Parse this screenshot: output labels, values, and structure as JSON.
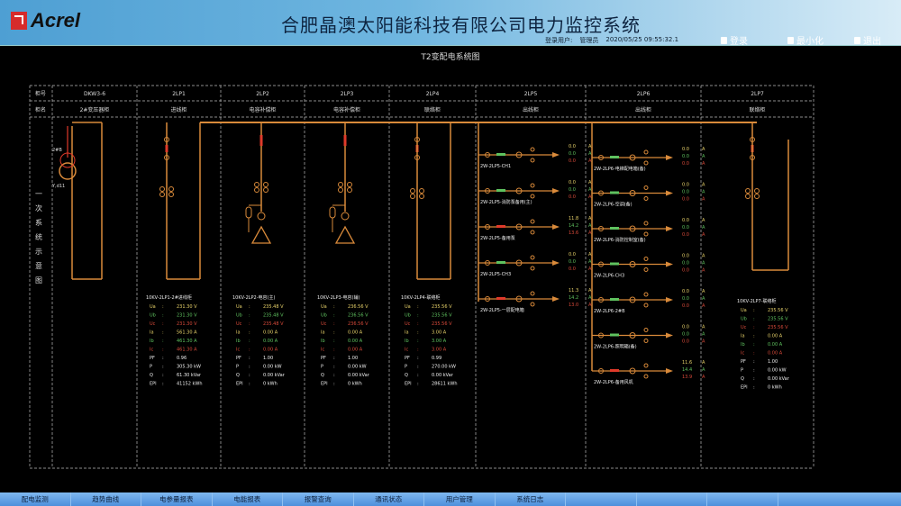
{
  "header": {
    "logo": "Acrel",
    "title": "合肥晶澳太阳能科技有限公司电力监控系统",
    "user_label": "登录用户:",
    "user": "管理员",
    "datetime": "2020/05/25  09:55:32.1",
    "buttons": [
      "登录",
      "最小化",
      "退出"
    ]
  },
  "page_title": "T2变配电系统图",
  "side_label": "一次系统示意图",
  "table": {
    "row_labels": [
      "柜号",
      "柜名"
    ],
    "columns": [
      {
        "id": "DKW3-6",
        "name": "2#变压器柜"
      },
      {
        "id": "2LP1",
        "name": "进线柜"
      },
      {
        "id": "2LP2",
        "name": "电容补偿柜"
      },
      {
        "id": "2LP3",
        "name": "电容补偿柜"
      },
      {
        "id": "2LP4",
        "name": "联络柜"
      },
      {
        "id": "2LP5",
        "name": "出线柜"
      },
      {
        "id": "2LP6",
        "name": "出线柜"
      },
      {
        "id": "2LP7",
        "name": "联络柜"
      }
    ]
  },
  "transformer": {
    "top": "2#B",
    "bottom": "Y,d11"
  },
  "meters": [
    {
      "title": "10KV-2LP1-2#进线柜",
      "rows": [
        [
          "Ua",
          "231.30 V"
        ],
        [
          "Ub",
          "231.30 V"
        ],
        [
          "Uc",
          "231.30 V"
        ],
        [
          "Ia",
          "561.30 A"
        ],
        [
          "Ib",
          "461.30 A"
        ],
        [
          "Ic",
          "461.30 A"
        ],
        [
          "PF",
          "0.96"
        ],
        [
          "P",
          "305.30 kW"
        ],
        [
          "Q",
          "61.30 kVar"
        ],
        [
          "EPI",
          "41152 kWh"
        ]
      ]
    },
    {
      "title": "10KV-2LP2-电容(主)",
      "rows": [
        [
          "Ua",
          "235.48 V"
        ],
        [
          "Ub",
          "235.48 V"
        ],
        [
          "Uc",
          "235.48 V"
        ],
        [
          "Ia",
          "0.00 A"
        ],
        [
          "Ib",
          "0.00 A"
        ],
        [
          "Ic",
          "0.00 A"
        ],
        [
          "PF",
          "1.00"
        ],
        [
          "P",
          "0.00 kW"
        ],
        [
          "Q",
          "0.00 kVar"
        ],
        [
          "EPI",
          "0 kWh"
        ]
      ]
    },
    {
      "title": "10KV-2LP3-电容(辅)",
      "rows": [
        [
          "Ua",
          "236.56 V"
        ],
        [
          "Ub",
          "236.56 V"
        ],
        [
          "Uc",
          "236.56 V"
        ],
        [
          "Ia",
          "0.00 A"
        ],
        [
          "Ib",
          "0.00 A"
        ],
        [
          "Ic",
          "0.00 A"
        ],
        [
          "PF",
          "1.00"
        ],
        [
          "P",
          "0.00 kW"
        ],
        [
          "Q",
          "0.00 kVar"
        ],
        [
          "EPI",
          "0 kWh"
        ]
      ]
    },
    {
      "title": "10KV-2LP4-联络柜",
      "rows": [
        [
          "Ua",
          "235.56 V"
        ],
        [
          "Ub",
          "235.56 V"
        ],
        [
          "Uc",
          "235.56 V"
        ],
        [
          "Ia",
          "3.00 A"
        ],
        [
          "Ib",
          "3.00 A"
        ],
        [
          "Ic",
          "3.00 A"
        ],
        [
          "PF",
          "0.99"
        ],
        [
          "P",
          "270.00 kW"
        ],
        [
          "Q",
          "0.00 kVar"
        ],
        [
          "EPI",
          "28611 kWh"
        ]
      ]
    },
    {
      "title": "10KV-2LP7-联络柜",
      "rows": [
        [
          "Ua",
          "235.56 V"
        ],
        [
          "Ub",
          "235.56 V"
        ],
        [
          "Uc",
          "235.56 V"
        ],
        [
          "Ia",
          "0.00 A"
        ],
        [
          "Ib",
          "0.00 A"
        ],
        [
          "Ic",
          "0.00 A"
        ],
        [
          "PF",
          "1.00"
        ],
        [
          "P",
          "0.00 kW"
        ],
        [
          "Q",
          "0.00 kVar"
        ],
        [
          "EPI",
          "0 kWh"
        ]
      ]
    }
  ],
  "feeders_2LP5": [
    {
      "label": "2W-2LP5-CH1",
      "values": [
        "0.0",
        "0.0",
        "0.0"
      ],
      "unit": "A",
      "alarm": false
    },
    {
      "label": "2W-2LP5-消防泵备用(主)",
      "values": [
        "0.0",
        "0.0",
        "0.0"
      ],
      "unit": "A",
      "alarm": false
    },
    {
      "label": "2W-2LP5-备用泵",
      "values": [
        "11.8",
        "14.2",
        "13.6"
      ],
      "unit": "A",
      "alarm": true
    },
    {
      "label": "2W-2LP5-CH3",
      "values": [
        "0.0",
        "0.0",
        "0.0"
      ],
      "unit": "A",
      "alarm": false
    },
    {
      "label": "2W-2LP5-一层配电箱",
      "values": [
        "11.3",
        "14.2",
        "13.0"
      ],
      "unit": "A",
      "alarm": true
    }
  ],
  "feeders_2LP6": [
    {
      "label": "2W-2LP6-电梯配电箱(备)",
      "values": [
        "0.0",
        "0.0",
        "0.0"
      ],
      "unit": "A",
      "alarm": false
    },
    {
      "label": "2W-2LP6-空调(备)",
      "values": [
        "0.0",
        "0.0",
        "0.0"
      ],
      "unit": "A",
      "alarm": false
    },
    {
      "label": "2W-2LP6-消防控制室(备)",
      "values": [
        "0.0",
        "0.0",
        "0.0"
      ],
      "unit": "A",
      "alarm": false
    },
    {
      "label": "2W-2LP6-CH3",
      "values": [
        "0.0",
        "0.0",
        "0.0"
      ],
      "unit": "A",
      "alarm": false
    },
    {
      "label": "2W-2LP6-2#B",
      "values": [
        "0.0",
        "0.0",
        "0.0"
      ],
      "unit": "A",
      "alarm": false
    },
    {
      "label": "2W-2LP6-照明箱(备)",
      "values": [
        "0.0",
        "0.0",
        "0.0"
      ],
      "unit": "A",
      "alarm": false
    },
    {
      "label": "2W-2LP6-备用风机",
      "values": [
        "11.6",
        "14.4",
        "13.9"
      ],
      "unit": "A",
      "alarm": true
    }
  ],
  "bottom_nav": [
    "配电监测",
    "趋势曲线",
    "电参量报表",
    "电能报表",
    "报警查询",
    "通讯状态",
    "用户管理",
    "系统日志"
  ],
  "colors": {
    "line": "#d98a3a",
    "phaseA": "#e8d26a",
    "phaseB": "#5fc25f",
    "phaseC": "#d84a3a",
    "alarm": "#e03a2a"
  }
}
